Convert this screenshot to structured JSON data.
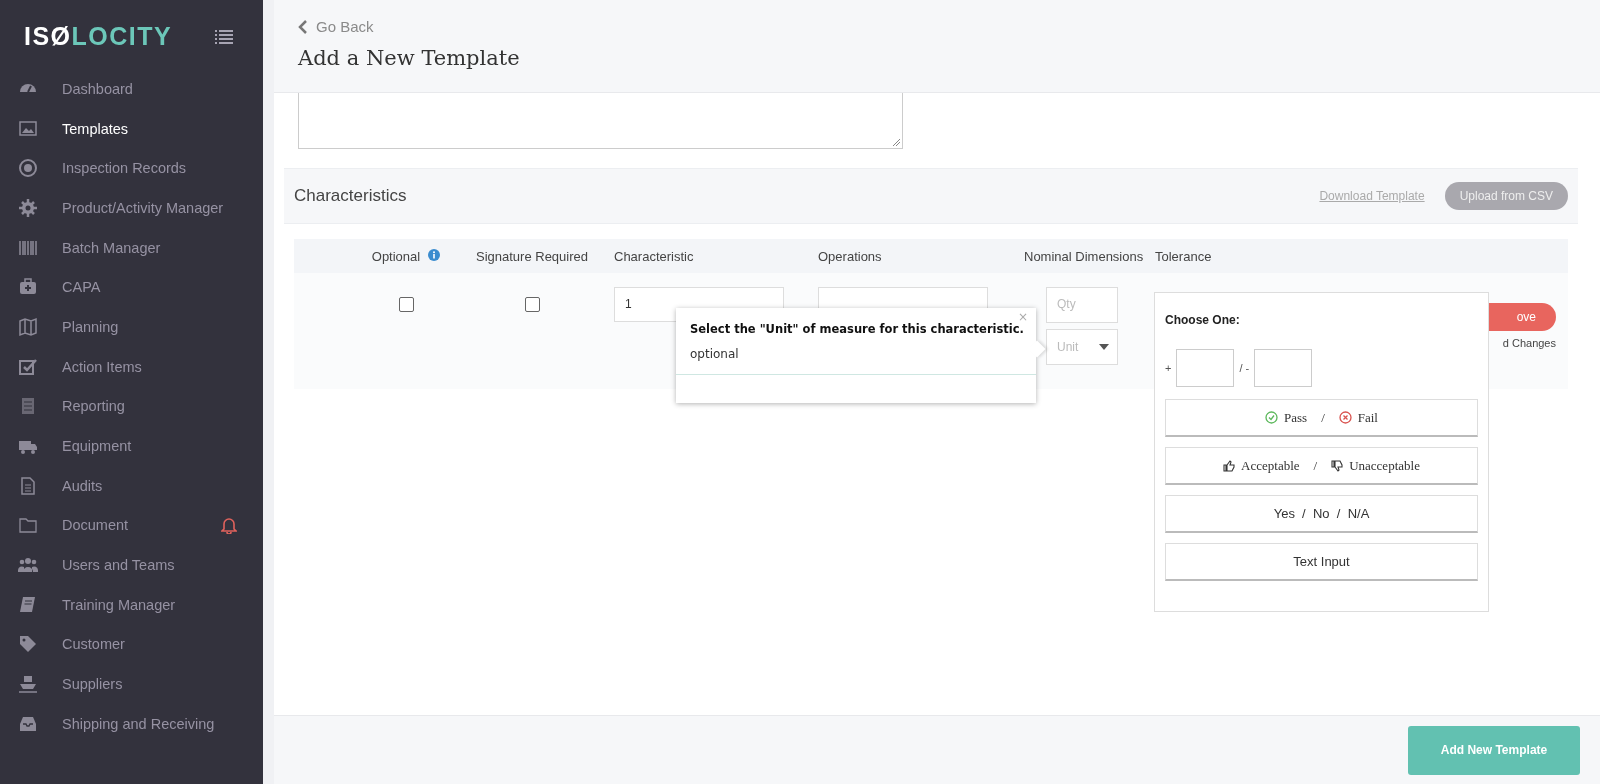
{
  "sidebar": {
    "logo": {
      "prefix": "ISØ",
      "suffix": "LOCITY"
    },
    "items": [
      {
        "label": "Dashboard",
        "selected": false
      },
      {
        "label": "Templates",
        "selected": true
      },
      {
        "label": "Inspection Records",
        "selected": false
      },
      {
        "label": "Product/Activity Manager",
        "selected": false
      },
      {
        "label": "Batch Manager",
        "selected": false
      },
      {
        "label": "CAPA",
        "selected": false
      },
      {
        "label": "Planning",
        "selected": false
      },
      {
        "label": "Action Items",
        "selected": false
      },
      {
        "label": "Reporting",
        "selected": false
      },
      {
        "label": "Equipment",
        "selected": false
      },
      {
        "label": "Audits",
        "selected": false
      },
      {
        "label": "Document",
        "selected": false,
        "alert": true
      },
      {
        "label": "Users and Teams",
        "selected": false
      },
      {
        "label": "Training Manager",
        "selected": false
      },
      {
        "label": "Customer",
        "selected": false
      },
      {
        "label": "Suppliers",
        "selected": false
      },
      {
        "label": "Shipping and Receiving",
        "selected": false
      }
    ]
  },
  "header": {
    "back": "Go Back",
    "title": "Add a New Template"
  },
  "characteristics": {
    "title": "Characteristics",
    "download_link": "Download Template",
    "upload_button": "Upload from CSV",
    "columns": [
      "Optional",
      "Signature Required",
      "Characteristic",
      "Operations",
      "Nominal Dimensions",
      "Tolerance"
    ],
    "row": {
      "optional": {
        "checked": false
      },
      "signature_required": {
        "checked": false
      },
      "characteristic": "1",
      "qty_placeholder": "Qty",
      "unit_placeholder": "Unit",
      "remove_button": "ove",
      "note": "d Changes"
    }
  },
  "tooltip": {
    "close": "×",
    "title": "Select the \"Unit\" of measure for this characteristic.",
    "text": "optional"
  },
  "tolerance_popup": {
    "title": "Choose One:",
    "plus": "+",
    "separator": "/ -",
    "options": [
      {
        "kind": "passfail",
        "parts": [
          "Pass",
          "/",
          "Fail"
        ]
      },
      {
        "kind": "thumbs",
        "parts": [
          "Acceptable",
          "/",
          "Unacceptable"
        ]
      },
      {
        "kind": "plain",
        "parts": [
          "Yes  /  No  /  N/A"
        ]
      },
      {
        "kind": "plain",
        "parts": [
          "Text Input"
        ]
      }
    ]
  },
  "footer": {
    "submit_button": "Add New Template"
  }
}
